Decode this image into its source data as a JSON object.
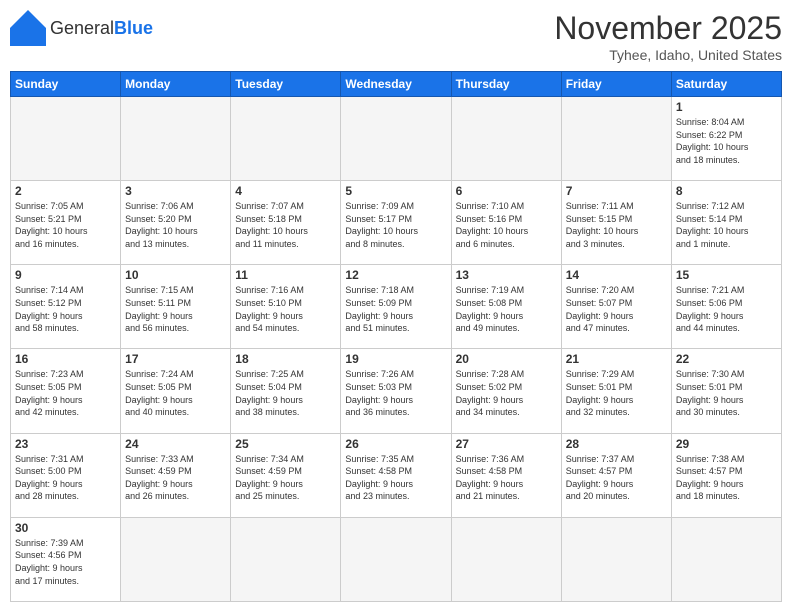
{
  "header": {
    "logo_general": "General",
    "logo_blue": "Blue",
    "month_title": "November 2025",
    "location": "Tyhee, Idaho, United States"
  },
  "weekdays": [
    "Sunday",
    "Monday",
    "Tuesday",
    "Wednesday",
    "Thursday",
    "Friday",
    "Saturday"
  ],
  "weeks": [
    [
      {
        "day": "",
        "info": "",
        "empty": true
      },
      {
        "day": "",
        "info": "",
        "empty": true
      },
      {
        "day": "",
        "info": "",
        "empty": true
      },
      {
        "day": "",
        "info": "",
        "empty": true
      },
      {
        "day": "",
        "info": "",
        "empty": true
      },
      {
        "day": "",
        "info": "",
        "empty": true
      },
      {
        "day": "1",
        "info": "Sunrise: 8:04 AM\nSunset: 6:22 PM\nDaylight: 10 hours\nand 18 minutes.",
        "empty": false
      }
    ],
    [
      {
        "day": "2",
        "info": "Sunrise: 7:05 AM\nSunset: 5:21 PM\nDaylight: 10 hours\nand 16 minutes.",
        "empty": false
      },
      {
        "day": "3",
        "info": "Sunrise: 7:06 AM\nSunset: 5:20 PM\nDaylight: 10 hours\nand 13 minutes.",
        "empty": false
      },
      {
        "day": "4",
        "info": "Sunrise: 7:07 AM\nSunset: 5:18 PM\nDaylight: 10 hours\nand 11 minutes.",
        "empty": false
      },
      {
        "day": "5",
        "info": "Sunrise: 7:09 AM\nSunset: 5:17 PM\nDaylight: 10 hours\nand 8 minutes.",
        "empty": false
      },
      {
        "day": "6",
        "info": "Sunrise: 7:10 AM\nSunset: 5:16 PM\nDaylight: 10 hours\nand 6 minutes.",
        "empty": false
      },
      {
        "day": "7",
        "info": "Sunrise: 7:11 AM\nSunset: 5:15 PM\nDaylight: 10 hours\nand 3 minutes.",
        "empty": false
      },
      {
        "day": "8",
        "info": "Sunrise: 7:12 AM\nSunset: 5:14 PM\nDaylight: 10 hours\nand 1 minute.",
        "empty": false
      }
    ],
    [
      {
        "day": "9",
        "info": "Sunrise: 7:14 AM\nSunset: 5:12 PM\nDaylight: 9 hours\nand 58 minutes.",
        "empty": false
      },
      {
        "day": "10",
        "info": "Sunrise: 7:15 AM\nSunset: 5:11 PM\nDaylight: 9 hours\nand 56 minutes.",
        "empty": false
      },
      {
        "day": "11",
        "info": "Sunrise: 7:16 AM\nSunset: 5:10 PM\nDaylight: 9 hours\nand 54 minutes.",
        "empty": false
      },
      {
        "day": "12",
        "info": "Sunrise: 7:18 AM\nSunset: 5:09 PM\nDaylight: 9 hours\nand 51 minutes.",
        "empty": false
      },
      {
        "day": "13",
        "info": "Sunrise: 7:19 AM\nSunset: 5:08 PM\nDaylight: 9 hours\nand 49 minutes.",
        "empty": false
      },
      {
        "day": "14",
        "info": "Sunrise: 7:20 AM\nSunset: 5:07 PM\nDaylight: 9 hours\nand 47 minutes.",
        "empty": false
      },
      {
        "day": "15",
        "info": "Sunrise: 7:21 AM\nSunset: 5:06 PM\nDaylight: 9 hours\nand 44 minutes.",
        "empty": false
      }
    ],
    [
      {
        "day": "16",
        "info": "Sunrise: 7:23 AM\nSunset: 5:05 PM\nDaylight: 9 hours\nand 42 minutes.",
        "empty": false
      },
      {
        "day": "17",
        "info": "Sunrise: 7:24 AM\nSunset: 5:05 PM\nDaylight: 9 hours\nand 40 minutes.",
        "empty": false
      },
      {
        "day": "18",
        "info": "Sunrise: 7:25 AM\nSunset: 5:04 PM\nDaylight: 9 hours\nand 38 minutes.",
        "empty": false
      },
      {
        "day": "19",
        "info": "Sunrise: 7:26 AM\nSunset: 5:03 PM\nDaylight: 9 hours\nand 36 minutes.",
        "empty": false
      },
      {
        "day": "20",
        "info": "Sunrise: 7:28 AM\nSunset: 5:02 PM\nDaylight: 9 hours\nand 34 minutes.",
        "empty": false
      },
      {
        "day": "21",
        "info": "Sunrise: 7:29 AM\nSunset: 5:01 PM\nDaylight: 9 hours\nand 32 minutes.",
        "empty": false
      },
      {
        "day": "22",
        "info": "Sunrise: 7:30 AM\nSunset: 5:01 PM\nDaylight: 9 hours\nand 30 minutes.",
        "empty": false
      }
    ],
    [
      {
        "day": "23",
        "info": "Sunrise: 7:31 AM\nSunset: 5:00 PM\nDaylight: 9 hours\nand 28 minutes.",
        "empty": false
      },
      {
        "day": "24",
        "info": "Sunrise: 7:33 AM\nSunset: 4:59 PM\nDaylight: 9 hours\nand 26 minutes.",
        "empty": false
      },
      {
        "day": "25",
        "info": "Sunrise: 7:34 AM\nSunset: 4:59 PM\nDaylight: 9 hours\nand 25 minutes.",
        "empty": false
      },
      {
        "day": "26",
        "info": "Sunrise: 7:35 AM\nSunset: 4:58 PM\nDaylight: 9 hours\nand 23 minutes.",
        "empty": false
      },
      {
        "day": "27",
        "info": "Sunrise: 7:36 AM\nSunset: 4:58 PM\nDaylight: 9 hours\nand 21 minutes.",
        "empty": false
      },
      {
        "day": "28",
        "info": "Sunrise: 7:37 AM\nSunset: 4:57 PM\nDaylight: 9 hours\nand 20 minutes.",
        "empty": false
      },
      {
        "day": "29",
        "info": "Sunrise: 7:38 AM\nSunset: 4:57 PM\nDaylight: 9 hours\nand 18 minutes.",
        "empty": false
      }
    ],
    [
      {
        "day": "30",
        "info": "Sunrise: 7:39 AM\nSunset: 4:56 PM\nDaylight: 9 hours\nand 17 minutes.",
        "empty": false
      },
      {
        "day": "",
        "info": "",
        "empty": true
      },
      {
        "day": "",
        "info": "",
        "empty": true
      },
      {
        "day": "",
        "info": "",
        "empty": true
      },
      {
        "day": "",
        "info": "",
        "empty": true
      },
      {
        "day": "",
        "info": "",
        "empty": true
      },
      {
        "day": "",
        "info": "",
        "empty": true
      }
    ]
  ]
}
